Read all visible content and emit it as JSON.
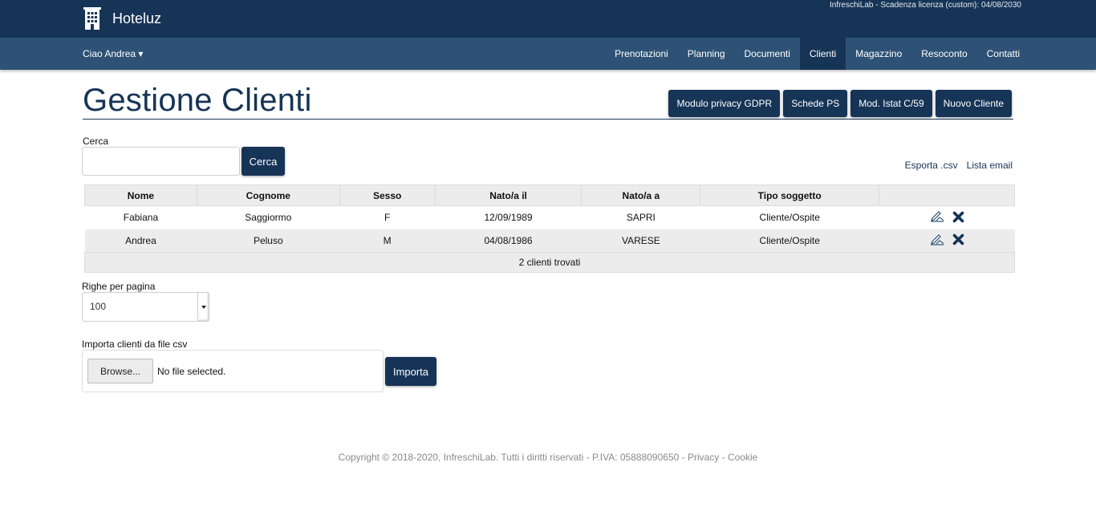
{
  "header": {
    "brand_icon": "hotel-building-icon",
    "brand_name": "Hoteluz",
    "license_text": "InfreschiLab - Scadenza licenza (custom): 04/08/2030"
  },
  "navbar": {
    "user_greeting": "Ciao Andrea ▾",
    "items": [
      {
        "label": "Prenotazioni",
        "active": false
      },
      {
        "label": "Planning",
        "active": false
      },
      {
        "label": "Documenti",
        "active": false
      },
      {
        "label": "Clienti",
        "active": true
      },
      {
        "label": "Magazzino",
        "active": false
      },
      {
        "label": "Resoconto",
        "active": false
      },
      {
        "label": "Contatti",
        "active": false
      }
    ]
  },
  "page": {
    "title": "Gestione Clienti",
    "buttons": [
      "Modulo privacy GDPR",
      "Schede PS",
      "Mod. Istat C/59",
      "Nuovo Cliente"
    ]
  },
  "search": {
    "label": "Cerca",
    "value": "",
    "button": "Cerca"
  },
  "links": {
    "export_csv": "Esporta .csv",
    "email_list": "Lista email"
  },
  "table": {
    "columns": [
      "Nome",
      "Cognome",
      "Sesso",
      "Nato/a il",
      "Nato/a a",
      "Tipo soggetto",
      ""
    ],
    "rows": [
      {
        "nome": "Fabiana",
        "cognome": "Saggiormo",
        "sesso": "F",
        "nato_il": "12/09/1989",
        "nato_a": "SAPRI",
        "tipo": "Cliente/Ospite"
      },
      {
        "nome": "Andrea",
        "cognome": "Peluso",
        "sesso": "M",
        "nato_il": "04/08/1986",
        "nato_a": "VARESE",
        "tipo": "Cliente/Ospite"
      }
    ],
    "row_action_icons": [
      "edit-icon",
      "delete-icon"
    ],
    "footer": "2 clienti trovati"
  },
  "pagination": {
    "label": "Righe per pagina",
    "value": "100"
  },
  "import": {
    "label": "Importa clienti da file csv",
    "browse_button": "Browse...",
    "file_status": "No file selected.",
    "button": "Importa"
  },
  "footer": {
    "copyright": "Copyright © 2018-2020, InfreschiLab. Tutti i diritti riservati - P.IVA: 05888090650 - ",
    "privacy": "Privacy",
    "separator": " - ",
    "cookie": "Cookie"
  },
  "colors": {
    "primary": "#163456",
    "navbar": "#2e5275",
    "table_header": "#ececec",
    "footer_text": "#8a8a8a"
  }
}
